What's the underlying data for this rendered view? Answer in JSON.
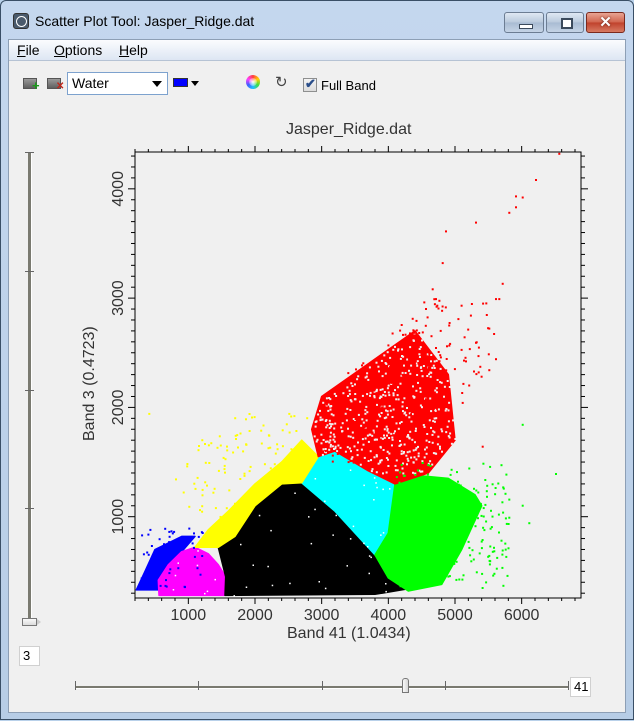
{
  "window": {
    "title": "Scatter Plot Tool: Jasper_Ridge.dat",
    "controls": {
      "minimize": "minimize",
      "maximize": "maximize",
      "close": "✕"
    }
  },
  "menu": [
    {
      "label": "File",
      "mnemonic": "F",
      "rest": "ile"
    },
    {
      "label": "Options",
      "mnemonic": "O",
      "rest": "ptions"
    },
    {
      "label": "Help",
      "mnemonic": "H",
      "rest": "elp"
    }
  ],
  "toolbar": {
    "add_class_icon": "add-class-icon",
    "delete_class_icon": "delete-class-icon",
    "class_select": {
      "value": "Water"
    },
    "class_color": {
      "value": "#0000ff"
    },
    "color_wheel_icon": "color-wheel-icon",
    "refresh_icon": "refresh-icon",
    "refresh_glyph": "↻",
    "full_band": {
      "label": "Full Band",
      "checked": true,
      "glyph": "✔"
    }
  },
  "sliders": {
    "y_band": {
      "value": "3",
      "position_fraction": 0.0
    },
    "x_band": {
      "value": "41",
      "position_fraction": 0.68
    }
  },
  "chart_data": {
    "type": "scatter",
    "title": "Jasper_Ridge.dat",
    "xlabel": "Band 41 (1.0434)",
    "ylabel": "Band 3 (0.4723)",
    "xlim": [
      200,
      6890
    ],
    "ylim": [
      256,
      4337
    ],
    "x_ticks": [
      1000,
      2000,
      3000,
      4000,
      5000,
      6000
    ],
    "y_ticks": [
      1000,
      2000,
      3000,
      4000
    ],
    "x_tick_labels": [
      "1000",
      "2000",
      "3000",
      "4000",
      "5000",
      "6000"
    ],
    "y_tick_labels": [
      "1000",
      "2000",
      "3000",
      "4000"
    ],
    "grid": false,
    "classes": [
      {
        "name": "Blue class",
        "color": "#0000ff",
        "region": [
          [
            220,
            330
          ],
          [
            560,
            330
          ],
          [
            820,
            560
          ],
          [
            900,
            680
          ],
          [
            1100,
            820
          ],
          [
            900,
            820
          ],
          [
            500,
            700
          ],
          [
            350,
            500
          ]
        ]
      },
      {
        "name": "Magenta class",
        "color": "#ff00ff",
        "region": [
          [
            560,
            280
          ],
          [
            1550,
            280
          ],
          [
            1560,
            450
          ],
          [
            1450,
            560
          ],
          [
            1300,
            660
          ],
          [
            1100,
            720
          ],
          [
            900,
            680
          ],
          [
            700,
            560
          ],
          [
            550,
            420
          ]
        ]
      },
      {
        "name": "Black class",
        "color": "#000000",
        "region": [
          [
            1550,
            280
          ],
          [
            3800,
            290
          ],
          [
            4300,
            340
          ],
          [
            4000,
            440
          ],
          [
            3800,
            650
          ],
          [
            3950,
            850
          ],
          [
            3200,
            1050
          ],
          [
            2700,
            1310
          ],
          [
            2400,
            1300
          ],
          [
            2000,
            1100
          ],
          [
            1700,
            820
          ],
          [
            1450,
            720
          ],
          [
            1560,
            450
          ]
        ]
      },
      {
        "name": "Cyan class",
        "color": "#00ffff",
        "region": [
          [
            2700,
            1310
          ],
          [
            3200,
            1050
          ],
          [
            3800,
            650
          ],
          [
            4000,
            850
          ],
          [
            4100,
            1300
          ],
          [
            3700,
            1420
          ],
          [
            3200,
            1600
          ],
          [
            2950,
            1550
          ]
        ]
      },
      {
        "name": "Green class",
        "color": "#00ff00",
        "region": [
          [
            4000,
            850
          ],
          [
            3800,
            650
          ],
          [
            4000,
            440
          ],
          [
            4300,
            320
          ],
          [
            4800,
            380
          ],
          [
            5100,
            700
          ],
          [
            5400,
            1100
          ],
          [
            5300,
            1200
          ],
          [
            4900,
            1350
          ],
          [
            4400,
            1380
          ],
          [
            4100,
            1300
          ]
        ]
      },
      {
        "name": "Yellow class",
        "color": "#ffff00",
        "region": [
          [
            1100,
            720
          ],
          [
            1450,
            720
          ],
          [
            1700,
            820
          ],
          [
            2000,
            1100
          ],
          [
            2400,
            1300
          ],
          [
            2700,
            1310
          ],
          [
            2950,
            1550
          ],
          [
            2700,
            1700
          ],
          [
            2400,
            1500
          ],
          [
            2000,
            1300
          ],
          [
            1600,
            1050
          ],
          [
            1300,
            880
          ]
        ]
      },
      {
        "name": "Red class",
        "color": "#ff0000",
        "region": [
          [
            2950,
            1550
          ],
          [
            3200,
            1600
          ],
          [
            3700,
            1420
          ],
          [
            4100,
            1300
          ],
          [
            4600,
            1400
          ],
          [
            5000,
            1700
          ],
          [
            4900,
            2300
          ],
          [
            4400,
            2700
          ],
          [
            3700,
            2400
          ],
          [
            3000,
            2100
          ],
          [
            2850,
            1800
          ]
        ]
      }
    ],
    "outlier_points": [
      {
        "class": "Red class",
        "points": [
          [
            6550,
            4330
          ],
          [
            6200,
            4090
          ],
          [
            5900,
            3940
          ],
          [
            6000,
            3930
          ],
          [
            5800,
            3790
          ],
          [
            5900,
            3840
          ],
          [
            5300,
            3700
          ],
          [
            4850,
            3620
          ],
          [
            4800,
            3330
          ],
          [
            5600,
            3000
          ],
          [
            5700,
            3140
          ],
          [
            5650,
            3000
          ],
          [
            4700,
            3000
          ],
          [
            4550,
            2910
          ],
          [
            4650,
            3090
          ],
          [
            4350,
            2820
          ],
          [
            5500,
            2730
          ],
          [
            5300,
            2600
          ],
          [
            5150,
            2430
          ],
          [
            5500,
            2350
          ],
          [
            4350,
            2580
          ],
          [
            3900,
            2400
          ],
          [
            4100,
            2200
          ],
          [
            5100,
            2050
          ],
          [
            5600,
            2450
          ],
          [
            4600,
            2500
          ],
          [
            5400,
            1650
          ],
          [
            4200,
            2300
          ],
          [
            3300,
            2100
          ]
        ]
      },
      {
        "class": "Yellow class",
        "points": [
          [
            400,
            1950
          ],
          [
            1700,
            1720
          ],
          [
            1300,
            1500
          ],
          [
            2400,
            1800
          ],
          [
            2200,
            1750
          ],
          [
            800,
            1350
          ],
          [
            1000,
            1100
          ],
          [
            1600,
            1250
          ],
          [
            2500,
            1950
          ],
          [
            1850,
            1900
          ]
        ]
      },
      {
        "class": "Green class",
        "points": [
          [
            6000,
            1850
          ],
          [
            6500,
            1400
          ],
          [
            6000,
            1110
          ],
          [
            5800,
            1000
          ],
          [
            6100,
            950
          ],
          [
            5700,
            700
          ],
          [
            5500,
            650
          ],
          [
            5000,
            1300
          ],
          [
            4500,
            1500
          ],
          [
            5200,
            1450
          ]
        ]
      },
      {
        "class": "Blue class",
        "points": [
          [
            700,
            870
          ],
          [
            900,
            800
          ],
          [
            1000,
            900
          ],
          [
            1200,
            860
          ]
        ]
      }
    ]
  }
}
